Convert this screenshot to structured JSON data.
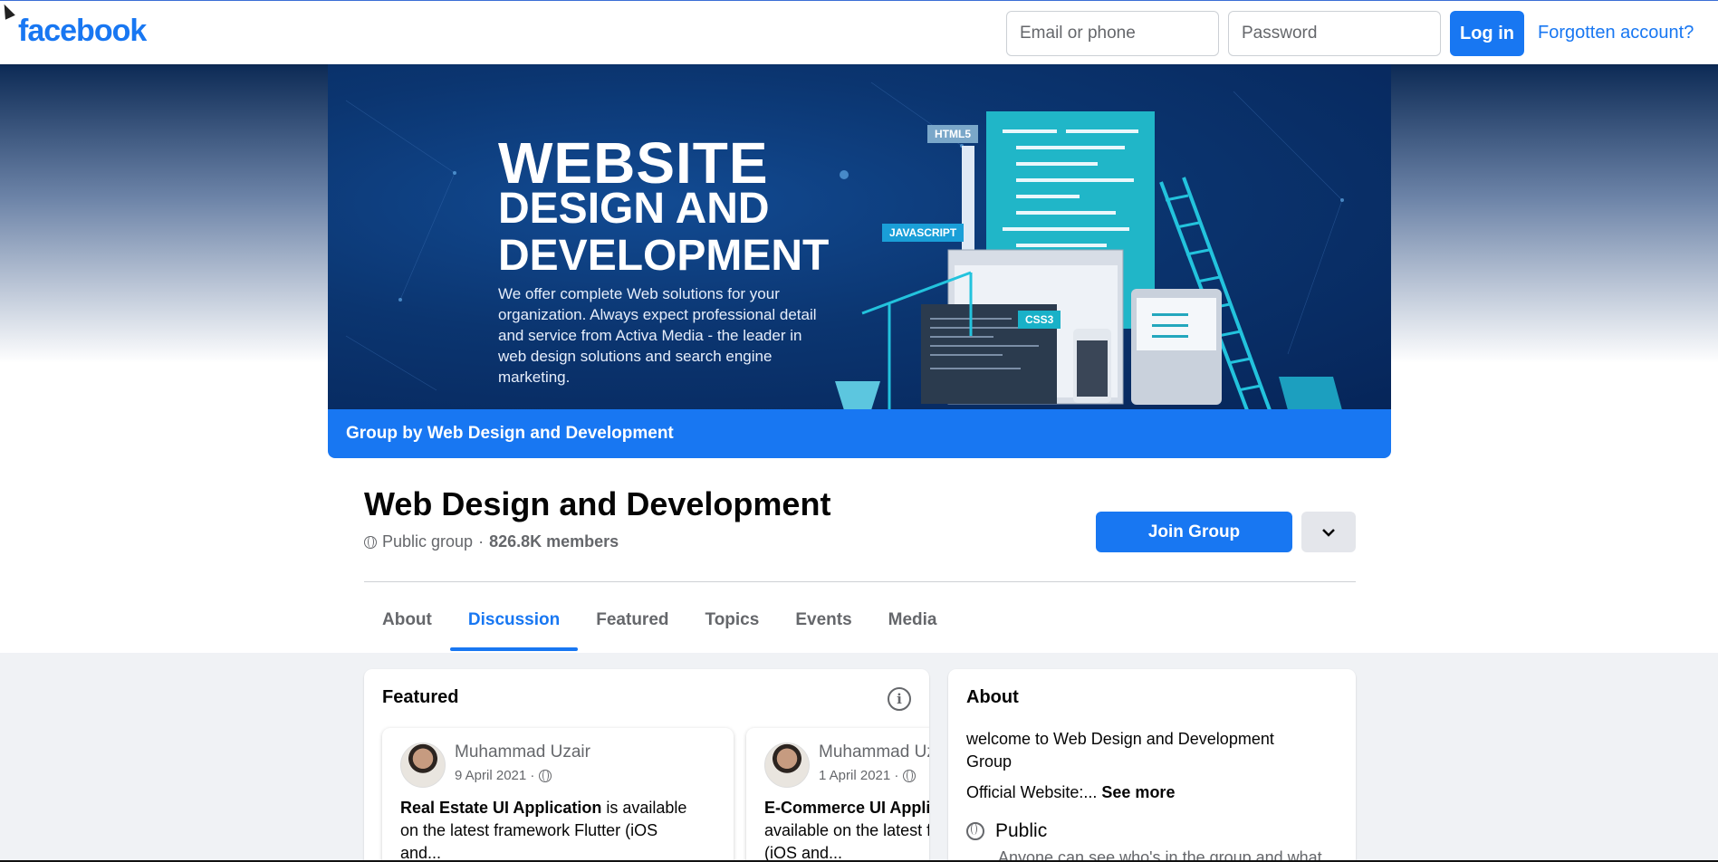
{
  "header": {
    "logo": "facebook",
    "email_placeholder": "Email or phone",
    "password_placeholder": "Password",
    "login_label": "Log in",
    "forgot_label": "Forgotten account?"
  },
  "cover": {
    "headline_1": "WEBSITE",
    "headline_2": "DESIGN AND DEVELOPMENT",
    "description": "We offer complete Web solutions for your organization. Always expect professional detail and service from Activa Media - the leader in web design solutions and search engine marketing.",
    "badge_html": "HTML5",
    "badge_js": "JAVASCRIPT",
    "badge_css": "CSS3",
    "banner_text": "Group by Web Design and Development"
  },
  "group": {
    "title": "Web Design and Development",
    "privacy": "Public group",
    "separator": "·",
    "members": "826.8K members",
    "join_label": "Join Group"
  },
  "tabs": [
    {
      "label": "About",
      "active": false
    },
    {
      "label": "Discussion",
      "active": true
    },
    {
      "label": "Featured",
      "active": false
    },
    {
      "label": "Topics",
      "active": false
    },
    {
      "label": "Events",
      "active": false
    },
    {
      "label": "Media",
      "active": false
    }
  ],
  "featured": {
    "heading": "Featured",
    "posts": [
      {
        "author": "Muhammad Uzair",
        "date": "9 April 2021 ·",
        "bold": "Real Estate UI Application",
        "text": " is available on the latest framework Flutter (iOS and..."
      },
      {
        "author": "Muhammad Uzair",
        "date": "1 April 2021 ·",
        "bold": "E-Commerce UI Application",
        "text": " is available on the latest framework Flutter (iOS and..."
      }
    ]
  },
  "about": {
    "heading": "About",
    "welcome": "welcome to Web Design and Development Group",
    "website": "Official Website:...",
    "see_more": "See more",
    "public_label": "Public",
    "public_desc": "Anyone can see who's in the group and what they post."
  },
  "colors": {
    "brand": "#1877f2",
    "secondary_text": "#65676b",
    "page_bg": "#f0f2f5"
  }
}
